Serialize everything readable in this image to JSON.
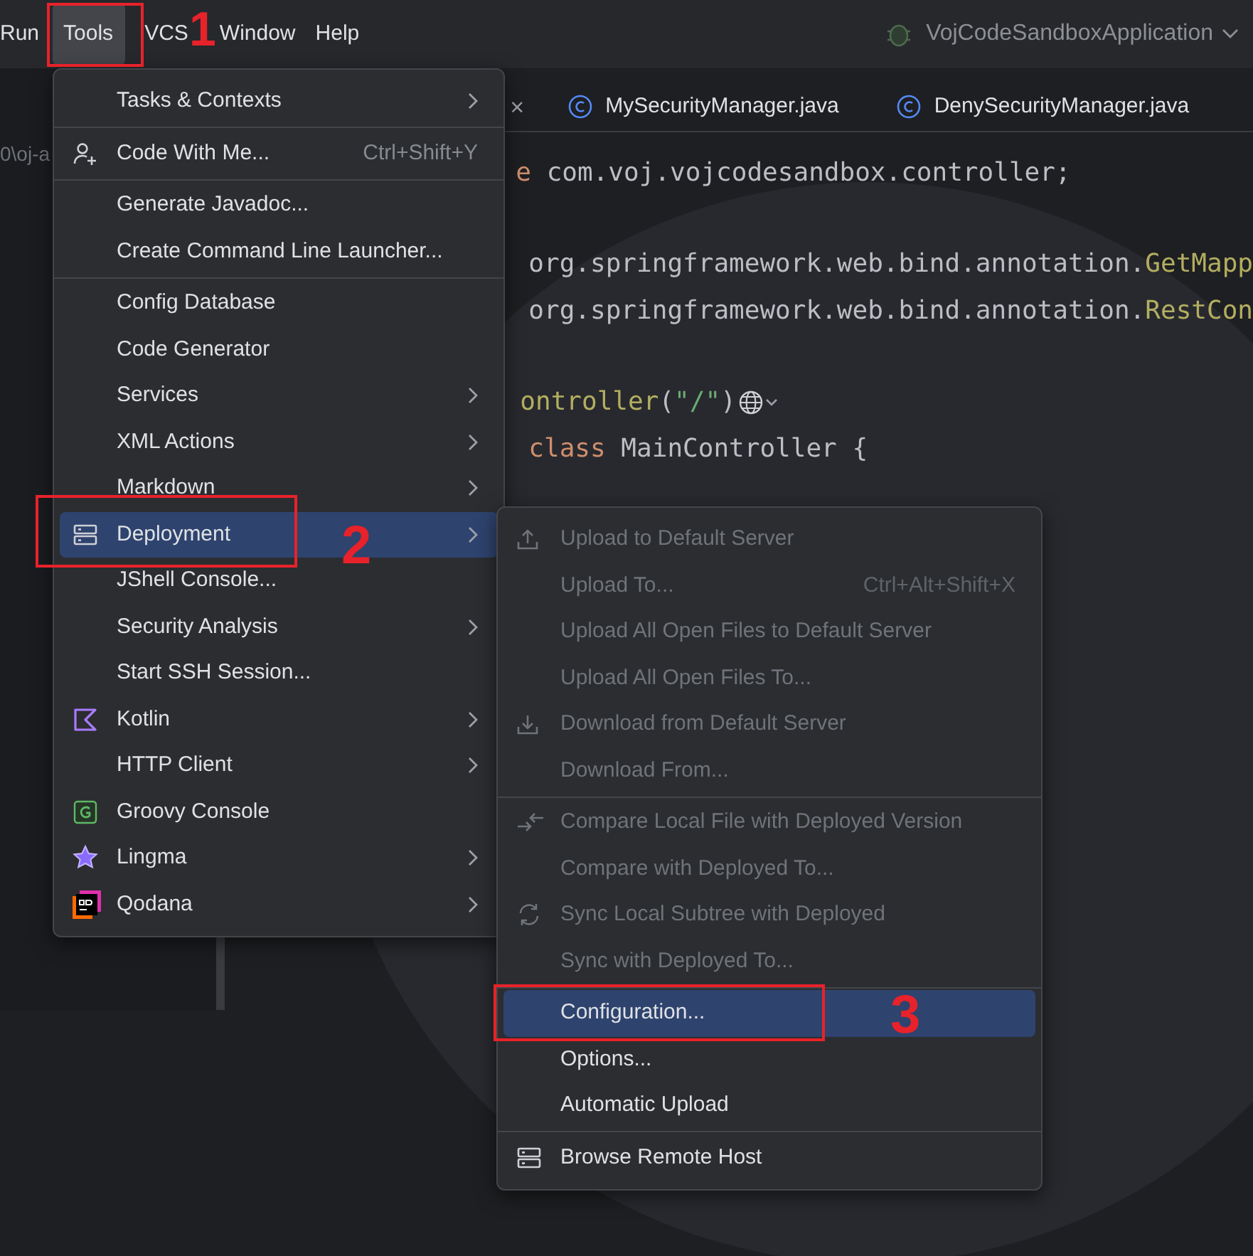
{
  "menu_bar": [
    {
      "label": "Run",
      "selected": false
    },
    {
      "label": "Tools",
      "selected": true
    },
    {
      "label": "VCS",
      "selected": false
    },
    {
      "label": "Window",
      "selected": false
    },
    {
      "label": "Help",
      "selected": false
    }
  ],
  "run_config": {
    "label": "VojCodeSandboxApplication"
  },
  "project_path": "0\\oj-a",
  "hidden_tab_close": "×",
  "editor_tabs": [
    {
      "label": "MySecurityManager.java"
    },
    {
      "label": "DenySecurityManager.java"
    }
  ],
  "code_lines": [
    {
      "tokens": [
        {
          "kind": "keyword",
          "text": "e"
        },
        {
          "kind": "plain",
          "text": " com.voj.vojcodesandbox.controller;"
        }
      ]
    },
    {
      "tokens": [
        {
          "kind": "plain",
          "text": "org.springframework.web.bind.annotation."
        },
        {
          "kind": "annotation",
          "text": "GetMapp"
        }
      ]
    },
    {
      "tokens": [
        {
          "kind": "plain",
          "text": "org.springframework.web.bind.annotation."
        },
        {
          "kind": "annotation",
          "text": "RestCon"
        }
      ]
    },
    {
      "tokens": [
        {
          "kind": "annotation",
          "text": "ontroller"
        },
        {
          "kind": "plain",
          "text": "("
        },
        {
          "kind": "string",
          "text": "\"/\""
        },
        {
          "kind": "plain",
          "text": ")"
        }
      ]
    },
    {
      "tokens": [
        {
          "kind": "keyword",
          "text": "class"
        },
        {
          "kind": "plain",
          "text": " MainController {"
        }
      ]
    }
  ],
  "tools_menu": [
    {
      "kind": "item",
      "label": "Tasks & Contexts",
      "submenu": true,
      "selected": false
    },
    {
      "kind": "separator"
    },
    {
      "kind": "item",
      "label": "Code With Me...",
      "shortcut": "Ctrl+Shift+Y",
      "submenu": false,
      "selected": false
    },
    {
      "kind": "separator"
    },
    {
      "kind": "item",
      "label": "Generate Javadoc...",
      "submenu": false,
      "selected": false
    },
    {
      "kind": "item",
      "label": "Create Command Line Launcher...",
      "submenu": false,
      "selected": false
    },
    {
      "kind": "separator"
    },
    {
      "kind": "item",
      "label": "Config Database",
      "submenu": false,
      "selected": false
    },
    {
      "kind": "item",
      "label": "Code Generator",
      "submenu": false,
      "selected": false
    },
    {
      "kind": "item",
      "label": "Services",
      "submenu": true,
      "selected": false
    },
    {
      "kind": "item",
      "label": "XML Actions",
      "submenu": true,
      "selected": false
    },
    {
      "kind": "item",
      "label": "Markdown",
      "submenu": true,
      "selected": false
    },
    {
      "kind": "item",
      "label": "Deployment",
      "submenu": true,
      "selected": true
    },
    {
      "kind": "item",
      "label": "JShell Console...",
      "submenu": false,
      "selected": false
    },
    {
      "kind": "item",
      "label": "Security Analysis",
      "submenu": true,
      "selected": false
    },
    {
      "kind": "item",
      "label": "Start SSH Session...",
      "submenu": false,
      "selected": false
    },
    {
      "kind": "item",
      "label": "Kotlin",
      "submenu": true,
      "selected": false
    },
    {
      "kind": "item",
      "label": "HTTP Client",
      "submenu": true,
      "selected": false
    },
    {
      "kind": "item",
      "label": "Groovy Console",
      "submenu": false,
      "selected": false
    },
    {
      "kind": "item",
      "label": "Lingma",
      "submenu": true,
      "selected": false
    },
    {
      "kind": "item",
      "label": "Qodana",
      "submenu": true,
      "selected": false
    }
  ],
  "deployment_menu": [
    {
      "kind": "item",
      "label": "Upload to Default Server",
      "disabled": true,
      "selected": false
    },
    {
      "kind": "item",
      "label": "Upload To...",
      "shortcut": "Ctrl+Alt+Shift+X",
      "disabled": true,
      "selected": false
    },
    {
      "kind": "item",
      "label": "Upload All Open Files to Default Server",
      "disabled": true,
      "selected": false
    },
    {
      "kind": "item",
      "label": "Upload All Open Files To...",
      "disabled": true,
      "selected": false
    },
    {
      "kind": "item",
      "label": "Download from Default Server",
      "disabled": true,
      "selected": false
    },
    {
      "kind": "item",
      "label": "Download From...",
      "disabled": true,
      "selected": false
    },
    {
      "kind": "separator"
    },
    {
      "kind": "item",
      "label": "Compare Local File with Deployed Version",
      "disabled": true,
      "selected": false
    },
    {
      "kind": "item",
      "label": "Compare with Deployed To...",
      "disabled": true,
      "selected": false
    },
    {
      "kind": "item",
      "label": "Sync Local Subtree with Deployed",
      "disabled": true,
      "selected": false
    },
    {
      "kind": "item",
      "label": "Sync with Deployed To...",
      "disabled": true,
      "selected": false
    },
    {
      "kind": "separator"
    },
    {
      "kind": "item",
      "label": "Configuration...",
      "disabled": false,
      "selected": true
    },
    {
      "kind": "item",
      "label": "Options...",
      "disabled": false,
      "selected": false
    },
    {
      "kind": "item",
      "label": "Automatic Upload",
      "disabled": false,
      "selected": false
    },
    {
      "kind": "separator"
    },
    {
      "kind": "item",
      "label": "Browse Remote Host",
      "disabled": false,
      "selected": false
    }
  ],
  "annotations": [
    {
      "number": "1"
    },
    {
      "number": "2"
    },
    {
      "number": "3"
    }
  ]
}
